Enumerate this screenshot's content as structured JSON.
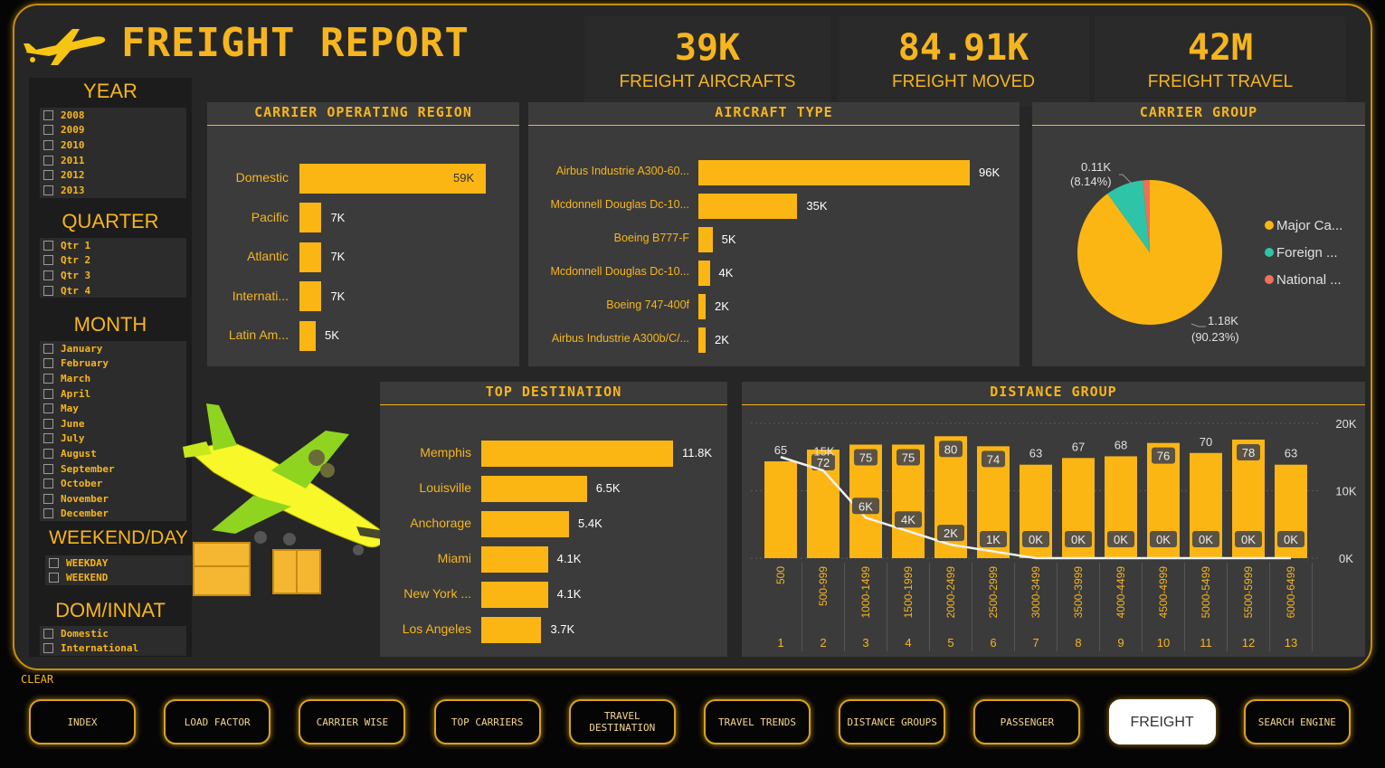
{
  "header": {
    "title": "FREIGHT REPORT"
  },
  "kpis": [
    {
      "value": "39K",
      "label": "FREIGHT AIRCRAFTS"
    },
    {
      "value": "84.91K",
      "label": "FREIGHT MOVED"
    },
    {
      "value": "42M",
      "label": "FREIGHT TRAVEL"
    }
  ],
  "slicers": {
    "year": {
      "title": "YEAR",
      "options": [
        "2008",
        "2009",
        "2010",
        "2011",
        "2012",
        "2013"
      ]
    },
    "quarter": {
      "title": "QUARTER",
      "options": [
        "Qtr 1",
        "Qtr 2",
        "Qtr 3",
        "Qtr 4"
      ]
    },
    "month": {
      "title": "MONTH",
      "options": [
        "January",
        "February",
        "March",
        "April",
        "May",
        "June",
        "July",
        "August",
        "September",
        "October",
        "November",
        "December"
      ]
    },
    "weekend": {
      "title": "WEEKEND/DAY",
      "options": [
        "WEEKDAY",
        "WEEKEND"
      ]
    },
    "dom": {
      "title": "DOM/INNAT",
      "options": [
        "Domestic",
        "International"
      ]
    }
  },
  "clear_label": "CLEAR",
  "panels": {
    "region": "CARRIER OPERATING REGION",
    "aircraft": "AIRCRAFT TYPE",
    "group": "CARRIER GROUP",
    "destination": "TOP DESTINATION",
    "distance": "DISTANCE GROUP"
  },
  "chart_data": [
    {
      "id": "region",
      "type": "bar",
      "orientation": "horizontal",
      "categories": [
        "Domestic",
        "Pacific",
        "Atlantic",
        "Internati...",
        "Latin Am..."
      ],
      "values": [
        59,
        7,
        7,
        7,
        5
      ],
      "data_labels": [
        "59K",
        "7K",
        "7K",
        "7K",
        "5K"
      ],
      "unit": "K",
      "color": "#fcb613"
    },
    {
      "id": "aircraft",
      "type": "bar",
      "orientation": "horizontal",
      "categories": [
        "Airbus Industrie A300-60...",
        "Mcdonnell Douglas Dc-10...",
        "Boeing B777-F",
        "Mcdonnell Douglas Dc-10...",
        "Boeing 747-400f",
        "Airbus Industrie A300b/C/..."
      ],
      "values": [
        96,
        35,
        5,
        4,
        2,
        2
      ],
      "data_labels": [
        "96K",
        "35K",
        "5K",
        "4K",
        "2K",
        "2K"
      ],
      "unit": "K",
      "color": "#fcb613"
    },
    {
      "id": "group",
      "type": "pie",
      "slices": [
        {
          "label": "Major Ca...",
          "value": 1.18,
          "data_label": "1.18K",
          "pct_label": "(90.23%)",
          "color": "#fcb613"
        },
        {
          "label": "Foreign ...",
          "value": 0.11,
          "data_label": "0.11K",
          "pct_label": "(8.14%)",
          "color": "#2ec4a8"
        },
        {
          "label": "National ...",
          "value": 0.02,
          "data_label": "",
          "pct_label": "",
          "color": "#f07058"
        }
      ],
      "legend": "right"
    },
    {
      "id": "destination",
      "type": "bar",
      "orientation": "horizontal",
      "categories": [
        "Memphis",
        "Louisville",
        "Anchorage",
        "Miami",
        "New York ...",
        "Los Angeles"
      ],
      "values": [
        11.8,
        6.5,
        5.4,
        4.1,
        4.1,
        3.7
      ],
      "data_labels": [
        "11.8K",
        "6.5K",
        "5.4K",
        "4.1K",
        "4.1K",
        "3.7K"
      ],
      "unit": "K",
      "color": "#fcb613"
    },
    {
      "id": "distance",
      "type": "bar",
      "categories": [
        "500",
        "500-999",
        "1000-1499",
        "1500-1999",
        "2000-2499",
        "2500-2999",
        "3000-3499",
        "3500-3999",
        "4000-4499",
        "4500-4999",
        "5000-5499",
        "5500-5999",
        "6000-6499"
      ],
      "x_numbers": [
        "1",
        "2",
        "3",
        "4",
        "5",
        "6",
        "7",
        "8",
        "9",
        "10",
        "11",
        "12",
        "13"
      ],
      "series": [
        {
          "type": "bar",
          "values": [
            65,
            72,
            75,
            75,
            80,
            74,
            63,
            67,
            68,
            76,
            70,
            78,
            63
          ]
        },
        {
          "type": "line",
          "values": [
            15,
            13,
            6,
            4,
            2,
            1,
            0,
            0,
            0,
            0,
            0,
            0,
            0
          ],
          "data_labels": [
            "15K",
            "",
            "6K",
            "4K",
            "2K",
            "1K",
            "0K",
            "0K",
            "0K",
            "0K",
            "0K",
            "0K",
            "0K"
          ],
          "unit": "K",
          "color": "#f2f2f2"
        }
      ],
      "y2_ticks": [
        "20K",
        "10K",
        "0K"
      ],
      "y2lim": [
        0,
        20
      ]
    }
  ],
  "nav": [
    "INDEX",
    "LOAD FACTOR",
    "CARRIER WISE",
    "TOP CARRIERS",
    "TRAVEL DESTINATION",
    "TRAVEL TRENDS",
    "DISTANCE GROUPS",
    "PASSENGER",
    "FREIGHT",
    "SEARCH ENGINE"
  ],
  "nav_active": "FREIGHT"
}
